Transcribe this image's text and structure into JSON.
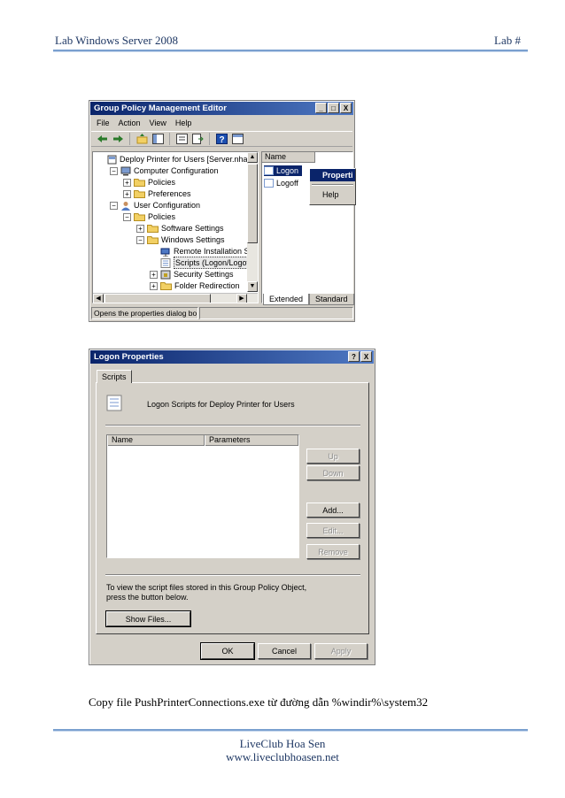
{
  "document": {
    "header_left": "Lab Windows Server 2008",
    "header_right": "Lab #",
    "caption": "Copy file PushPrinterConnections.exe từ đường dẫn %windir%\\system32",
    "footer_line1": "LiveClub Hoa Sen",
    "footer_line2": "www.liveclubhoasen.net"
  },
  "gpme": {
    "title": "Group Policy Management Editor",
    "title_buttons": [
      "_",
      "□",
      "X"
    ],
    "menu": [
      "File",
      "Action",
      "View",
      "Help"
    ],
    "toolbar_icons": [
      "back-arrow-icon",
      "forward-arrow-icon",
      "up-folder-icon",
      "show-tree-icon",
      "properties-icon",
      "export-icon",
      "help-icon",
      "console-icon"
    ],
    "tree": [
      {
        "label": "Deploy Printer for Users [Server.nhatng",
        "level": 0,
        "expander": "",
        "icon": "gpo-icon"
      },
      {
        "label": "Computer Configuration",
        "level": 1,
        "expander": "−",
        "icon": "computer-icon"
      },
      {
        "label": "Policies",
        "level": 2,
        "expander": "+",
        "icon": "folder-icon"
      },
      {
        "label": "Preferences",
        "level": 2,
        "expander": "+",
        "icon": "folder-icon"
      },
      {
        "label": "User Configuration",
        "level": 1,
        "expander": "−",
        "icon": "user-icon"
      },
      {
        "label": "Policies",
        "level": 2,
        "expander": "−",
        "icon": "folder-icon"
      },
      {
        "label": "Software Settings",
        "level": 3,
        "expander": "+",
        "icon": "folder-icon"
      },
      {
        "label": "Windows Settings",
        "level": 3,
        "expander": "−",
        "icon": "folder-icon"
      },
      {
        "label": "Remote Installation Serv",
        "level": 4,
        "expander": "",
        "icon": "remote-install-icon"
      },
      {
        "label": "Scripts (Logon/Logoff)",
        "level": 4,
        "expander": "",
        "icon": "script-icon",
        "selected": true
      },
      {
        "label": "Security Settings",
        "level": 4,
        "expander": "+",
        "icon": "security-icon"
      },
      {
        "label": "Folder Redirection",
        "level": 4,
        "expander": "+",
        "icon": "folder-icon"
      }
    ],
    "list_header": "Name",
    "list_items": [
      {
        "label": "Logon",
        "selected": true
      },
      {
        "label": "Logoff",
        "selected": false
      }
    ],
    "context_menu": [
      {
        "label": "Properti",
        "selected": true
      },
      {
        "label": "Help",
        "selected": false
      }
    ],
    "tabs": [
      "Extended",
      "Standard"
    ],
    "status": "Opens the properties dialog bo"
  },
  "dialog": {
    "title": "Logon Properties",
    "title_buttons": [
      "?",
      "X"
    ],
    "tab": "Scripts",
    "heading": "Logon Scripts for Deploy Printer for Users",
    "columns": [
      "Name",
      "Parameters"
    ],
    "side_buttons": [
      {
        "label": "Up",
        "disabled": true
      },
      {
        "label": "Down",
        "disabled": true
      },
      {
        "label": "Add...",
        "disabled": false
      },
      {
        "label": "Edit...",
        "disabled": true
      },
      {
        "label": "Remove",
        "disabled": true
      }
    ],
    "info_text": "To view the script files stored in this Group Policy Object, press the button below.",
    "show_files": "Show Files...",
    "ok": "OK",
    "cancel": "Cancel",
    "apply": "Apply"
  }
}
